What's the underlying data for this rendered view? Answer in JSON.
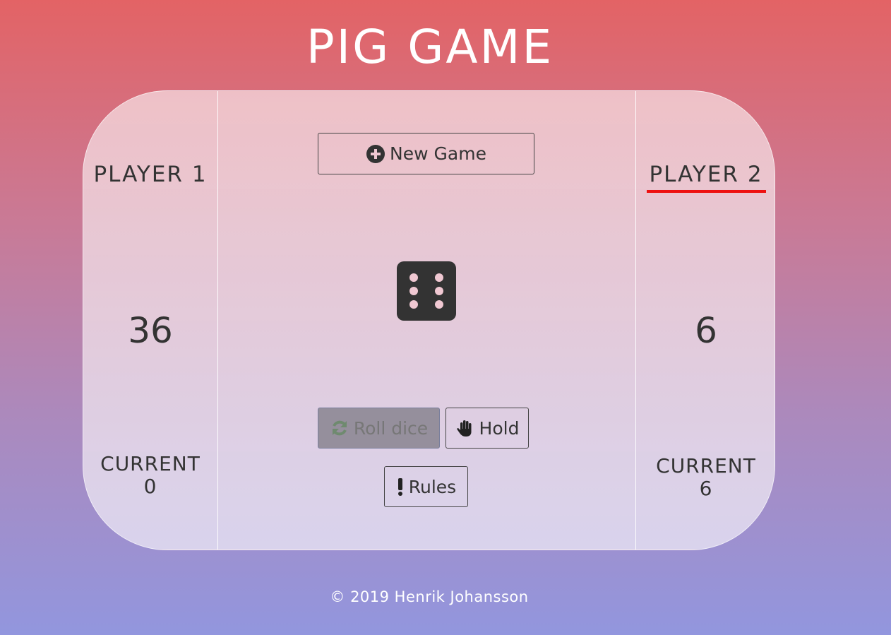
{
  "title": "PIG GAME",
  "players": [
    {
      "name": "PLAYER 1",
      "score": "36",
      "current_label": "CURRENT",
      "current": "0",
      "active": false
    },
    {
      "name": "PLAYER 2",
      "score": "6",
      "current_label": "CURRENT",
      "current": "6",
      "active": true
    }
  ],
  "controls": {
    "new_game": "New Game",
    "roll_dice": "Roll dice",
    "hold": "Hold",
    "rules": "Rules"
  },
  "dice": {
    "value": 6,
    "icon": "dice-six-icon"
  },
  "colors": {
    "active_underline": "#ee1111",
    "dice": "#333333"
  },
  "footer": "© 2019 Henrik Johansson"
}
